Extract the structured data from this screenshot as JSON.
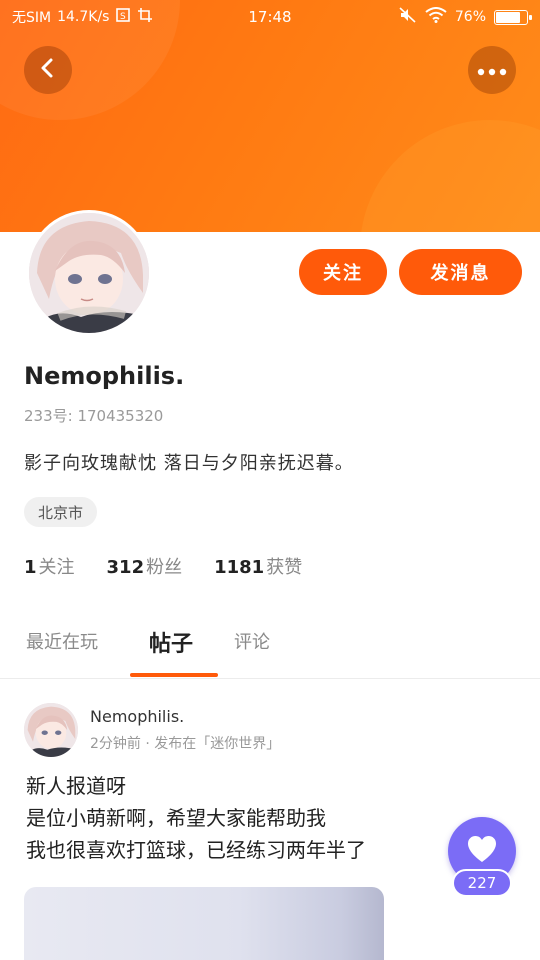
{
  "status_bar": {
    "carrier": "无SIM",
    "speed": "14.7K/s",
    "time": "17:48",
    "battery": "76%",
    "battery_level": 0.76
  },
  "header": {
    "back_icon": "chevron-left-icon",
    "more_icon": "more-dots-icon"
  },
  "profile": {
    "follow_label": "关注",
    "message_label": "发消息",
    "username": "Nemophilis.",
    "uid": "233号: 170435320",
    "bio": "影子向玫瑰献忱 落日与夕阳亲抚迟暮。",
    "location": "北京市",
    "stats": [
      {
        "num": "1",
        "label": "关注"
      },
      {
        "num": "312",
        "label": "粉丝"
      },
      {
        "num": "1181",
        "label": "获赞"
      }
    ]
  },
  "tabs": [
    {
      "label": "最近在玩"
    },
    {
      "label": "帖子"
    },
    {
      "label": "评论"
    }
  ],
  "post": {
    "author": "Nemophilis.",
    "meta": "2分钟前 · 发布在「迷你世界」",
    "lines": [
      "新人报道呀",
      "是位小萌新啊，希望大家能帮助我",
      "我也很喜欢打篮球，已经练习两年半了"
    ]
  },
  "like": {
    "count": "227",
    "icon": "heart-icon"
  },
  "colors": {
    "accent": "#ff5a0a",
    "header_orange": "#ff7a12",
    "like_purple": "#7b6cf6"
  }
}
